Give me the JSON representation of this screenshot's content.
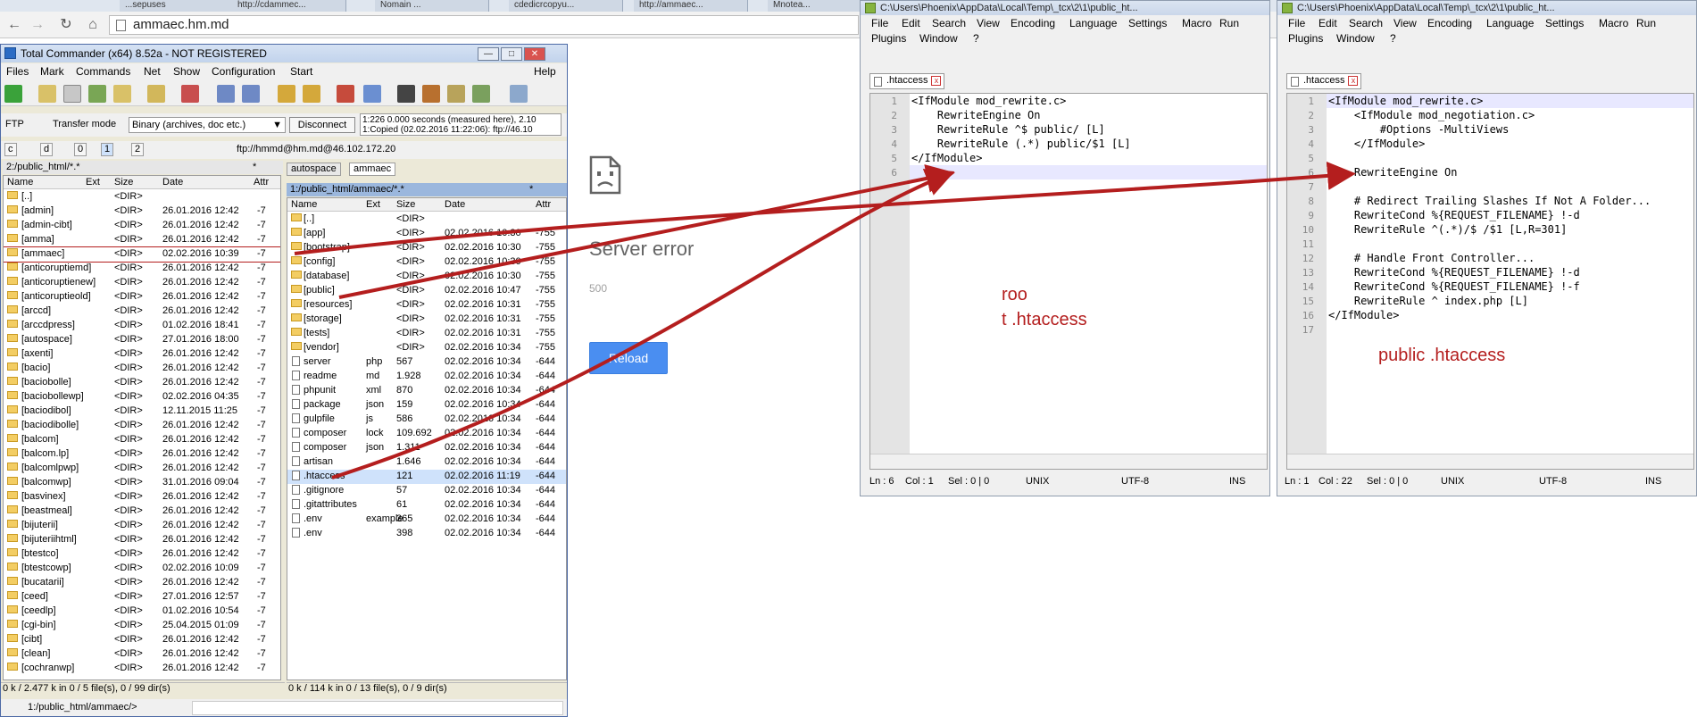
{
  "browser": {
    "url": "ammaec.hm.md",
    "tabs": [
      "...sepuses",
      "http://cdammec...",
      "Nomain ...",
      "cdedicrcopyu...",
      "http://ammaec...",
      "Mnotea..."
    ]
  },
  "page": {
    "error_title": "Server error",
    "error_code": "500",
    "reload_label": "Reload"
  },
  "tc": {
    "title": "Total Commander (x64) 8.52a - NOT REGISTERED",
    "menu": [
      "Files",
      "Mark",
      "Commands",
      "Net",
      "Show",
      "Configuration",
      "Start",
      "Help"
    ],
    "ftp_label": "FTP",
    "transfer_label": "Transfer mode",
    "transfer_value": "Binary (archives, doc etc.)",
    "disconnect_label": "Disconnect",
    "log_line1": "1:226 0.000 seconds (measured here), 2.10",
    "log_line2": "1:Copied (02.02.2016 11:22:06): ftp://46.10",
    "drives": [
      "c",
      "d",
      "0",
      "1",
      "2"
    ],
    "ftp_path": "ftp://hmmd@hm.md@46.102.172.20",
    "left": {
      "path": "2:/public_html/*.*",
      "filter": "*",
      "cols": [
        "Name",
        "Ext",
        "Size",
        "Date",
        "Attr"
      ],
      "rows": [
        [
          "[..]",
          "",
          "<DIR>",
          "",
          ""
        ],
        [
          "[admin]",
          "",
          "<DIR>",
          "26.01.2016 12:42",
          "-7"
        ],
        [
          "[admin-cibt]",
          "",
          "<DIR>",
          "26.01.2016 12:42",
          "-7"
        ],
        [
          "[amma]",
          "",
          "<DIR>",
          "26.01.2016 12:42",
          "-7"
        ],
        [
          "[ammaec]",
          "",
          "<DIR>",
          "02.02.2016 10:39",
          "-7"
        ],
        [
          "[anticoruptiemd]",
          "",
          "<DIR>",
          "26.01.2016 12:42",
          "-7"
        ],
        [
          "[anticoruptienew]",
          "",
          "<DIR>",
          "26.01.2016 12:42",
          "-7"
        ],
        [
          "[anticoruptieold]",
          "",
          "<DIR>",
          "26.01.2016 12:42",
          "-7"
        ],
        [
          "[arccd]",
          "",
          "<DIR>",
          "26.01.2016 12:42",
          "-7"
        ],
        [
          "[arccdpress]",
          "",
          "<DIR>",
          "01.02.2016 18:41",
          "-7"
        ],
        [
          "[autospace]",
          "",
          "<DIR>",
          "27.01.2016 18:00",
          "-7"
        ],
        [
          "[axenti]",
          "",
          "<DIR>",
          "26.01.2016 12:42",
          "-7"
        ],
        [
          "[bacio]",
          "",
          "<DIR>",
          "26.01.2016 12:42",
          "-7"
        ],
        [
          "[baciobolle]",
          "",
          "<DIR>",
          "26.01.2016 12:42",
          "-7"
        ],
        [
          "[baciobollewp]",
          "",
          "<DIR>",
          "02.02.2016 04:35",
          "-7"
        ],
        [
          "[baciodibol]",
          "",
          "<DIR>",
          "12.11.2015 11:25",
          "-7"
        ],
        [
          "[baciodibolle]",
          "",
          "<DIR>",
          "26.01.2016 12:42",
          "-7"
        ],
        [
          "[balcom]",
          "",
          "<DIR>",
          "26.01.2016 12:42",
          "-7"
        ],
        [
          "[balcom.lp]",
          "",
          "<DIR>",
          "26.01.2016 12:42",
          "-7"
        ],
        [
          "[balcomlpwp]",
          "",
          "<DIR>",
          "26.01.2016 12:42",
          "-7"
        ],
        [
          "[balcomwp]",
          "",
          "<DIR>",
          "31.01.2016 09:04",
          "-7"
        ],
        [
          "[basvinex]",
          "",
          "<DIR>",
          "26.01.2016 12:42",
          "-7"
        ],
        [
          "[beastmeal]",
          "",
          "<DIR>",
          "26.01.2016 12:42",
          "-7"
        ],
        [
          "[bijuterii]",
          "",
          "<DIR>",
          "26.01.2016 12:42",
          "-7"
        ],
        [
          "[bijuteriihtml]",
          "",
          "<DIR>",
          "26.01.2016 12:42",
          "-7"
        ],
        [
          "[btestco]",
          "",
          "<DIR>",
          "26.01.2016 12:42",
          "-7"
        ],
        [
          "[btestcowp]",
          "",
          "<DIR>",
          "02.02.2016 10:09",
          "-7"
        ],
        [
          "[bucatarii]",
          "",
          "<DIR>",
          "26.01.2016 12:42",
          "-7"
        ],
        [
          "[ceed]",
          "",
          "<DIR>",
          "27.01.2016 12:57",
          "-7"
        ],
        [
          "[ceedlp]",
          "",
          "<DIR>",
          "01.02.2016 10:54",
          "-7"
        ],
        [
          "[cgi-bin]",
          "",
          "<DIR>",
          "25.04.2015 01:09",
          "-7"
        ],
        [
          "[cibt]",
          "",
          "<DIR>",
          "26.01.2016 12:42",
          "-7"
        ],
        [
          "[clean]",
          "",
          "<DIR>",
          "26.01.2016 12:42",
          "-7"
        ],
        [
          "[cochranwp]",
          "",
          "<DIR>",
          "26.01.2016 12:42",
          "-7"
        ]
      ],
      "status": "0 k / 2.477 k in 0 / 5 file(s), 0 / 99 dir(s)"
    },
    "right": {
      "tabs": [
        "autospace",
        "ammaec"
      ],
      "path": "1:/public_html/ammaec/*.*",
      "filter": "*",
      "cols": [
        "Name",
        "Ext",
        "Size",
        "Date",
        "Attr"
      ],
      "rows": [
        [
          "[..]",
          "",
          "<DIR>",
          "",
          ""
        ],
        [
          "[app]",
          "",
          "<DIR>",
          "02.02.2016 10:30",
          "-755"
        ],
        [
          "[bootstrap]",
          "",
          "<DIR>",
          "02.02.2016 10:30",
          "-755"
        ],
        [
          "[config]",
          "",
          "<DIR>",
          "02.02.2016 10:30",
          "-755"
        ],
        [
          "[database]",
          "",
          "<DIR>",
          "02.02.2016 10:30",
          "-755"
        ],
        [
          "[public]",
          "",
          "<DIR>",
          "02.02.2016 10:47",
          "-755"
        ],
        [
          "[resources]",
          "",
          "<DIR>",
          "02.02.2016 10:31",
          "-755"
        ],
        [
          "[storage]",
          "",
          "<DIR>",
          "02.02.2016 10:31",
          "-755"
        ],
        [
          "[tests]",
          "",
          "<DIR>",
          "02.02.2016 10:31",
          "-755"
        ],
        [
          "[vendor]",
          "",
          "<DIR>",
          "02.02.2016 10:34",
          "-755"
        ],
        [
          "server",
          "php",
          "567",
          "02.02.2016 10:34",
          "-644"
        ],
        [
          "readme",
          "md",
          "1.928",
          "02.02.2016 10:34",
          "-644"
        ],
        [
          "phpunit",
          "xml",
          "870",
          "02.02.2016 10:34",
          "-644"
        ],
        [
          "package",
          "json",
          "159",
          "02.02.2016 10:34",
          "-644"
        ],
        [
          "gulpfile",
          "js",
          "586",
          "02.02.2016 10:34",
          "-644"
        ],
        [
          "composer",
          "lock",
          "109.692",
          "02.02.2016 10:34",
          "-644"
        ],
        [
          "composer",
          "json",
          "1.311",
          "02.02.2016 10:34",
          "-644"
        ],
        [
          "artisan",
          "",
          "1.646",
          "02.02.2016 10:34",
          "-644"
        ],
        [
          ".htaccess",
          "",
          "121",
          "02.02.2016 11:19",
          "-644"
        ],
        [
          ".gitignore",
          "",
          "57",
          "02.02.2016 10:34",
          "-644"
        ],
        [
          ".gitattributes",
          "",
          "61",
          "02.02.2016 10:34",
          "-644"
        ],
        [
          ".env",
          "example",
          "365",
          "02.02.2016 10:34",
          "-644"
        ],
        [
          ".env",
          "",
          "398",
          "02.02.2016 10:34",
          "-644"
        ]
      ],
      "status": "0 k / 114 k in 0 / 13 file(s), 0 / 9 dir(s)"
    },
    "cmd_path": "1:/public_html/ammaec/>"
  },
  "npp1": {
    "title": "C:\\Users\\Phoenix\\AppData\\Local\\Temp\\_tcx\\2\\1\\public_ht...",
    "menu": [
      "File",
      "Edit",
      "Search",
      "View",
      "Encoding",
      "Language",
      "Settings",
      "Macro",
      "Run",
      "Plugins",
      "Window",
      "?"
    ],
    "tab": ".htaccess",
    "lines": [
      "<IfModule mod_rewrite.c>",
      "    RewriteEngine On",
      "    RewriteRule ^$ public/ [L]",
      "    RewriteRule (.*) public/$1 [L]",
      "</IfModule>",
      ""
    ],
    "annotation1": "roo",
    "annotation2": "t .htaccess",
    "status": {
      "ln": "Ln : 6",
      "col": "Col : 1",
      "sel": "Sel : 0 | 0",
      "eol": "UNIX",
      "enc": "UTF-8",
      "ins": "INS"
    }
  },
  "npp2": {
    "title": "C:\\Users\\Phoenix\\AppData\\Local\\Temp\\_tcx\\2\\1\\public_ht...",
    "menu": [
      "File",
      "Edit",
      "Search",
      "View",
      "Encoding",
      "Language",
      "Settings",
      "Macro",
      "Run",
      "Plugins",
      "Window",
      "?"
    ],
    "tab": ".htaccess",
    "lines": [
      "<IfModule mod_rewrite.c>",
      "    <IfModule mod_negotiation.c>",
      "        #Options -MultiViews",
      "    </IfModule>",
      "",
      "    RewriteEngine On",
      "",
      "    # Redirect Trailing Slashes If Not A Folder...",
      "    RewriteCond %{REQUEST_FILENAME} !-d",
      "    RewriteRule ^(.*)/$ /$1 [L,R=301]",
      "",
      "    # Handle Front Controller...",
      "    RewriteCond %{REQUEST_FILENAME} !-d",
      "    RewriteCond %{REQUEST_FILENAME} !-f",
      "    RewriteRule ^ index.php [L]",
      "</IfModule>",
      ""
    ],
    "annotation": "public .htaccess",
    "status": {
      "ln": "Ln : 1",
      "col": "Col : 22",
      "sel": "Sel : 0 | 0",
      "eol": "UNIX",
      "enc": "UTF-8",
      "ins": "INS"
    }
  },
  "colors": {
    "annotation": "#b41e1e",
    "tc_selection": "#cfe2fb",
    "npp_curline": "#e8e8ff",
    "reload": "#4a8ef1"
  }
}
